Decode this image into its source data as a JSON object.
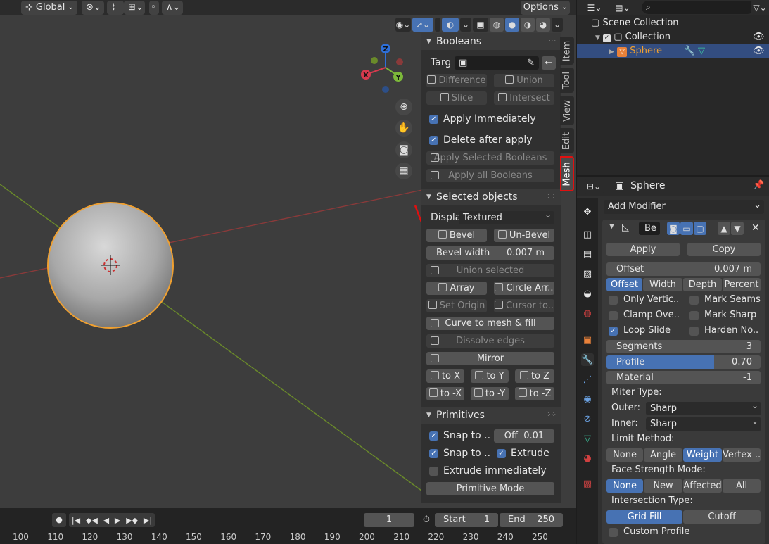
{
  "header": {
    "orientation": "Global",
    "options": "Options"
  },
  "booleans": {
    "title": "Booleans",
    "target_label": "Targ",
    "difference": "Difference",
    "union": "Union",
    "slice": "Slice",
    "intersect": "Intersect",
    "apply_immediately": "Apply Immediately",
    "delete_after_apply": "Delete after apply",
    "apply_selected": "Apply Selected Booleans",
    "apply_all": "Apply all Booleans"
  },
  "selected": {
    "title": "Selected objects",
    "display_label": "Displa",
    "display_value": "Textured",
    "bevel": "Bevel",
    "unbevel": "Un-Bevel",
    "bevel_width_label": "Bevel width",
    "bevel_width_value": "0.007 m",
    "union_selected": "Union selected",
    "array": "Array",
    "circle_array": "Circle Arr..",
    "set_origin": "Set Origin",
    "cursor_to": "Cursor to..",
    "curve_to_mesh": "Curve to mesh & fill",
    "dissolve_edges": "Dissolve edges",
    "mirror": "Mirror",
    "to_x": "to X",
    "to_y": "to Y",
    "to_z": "to Z",
    "to_nx": "to -X",
    "to_ny": "to -Y",
    "to_nz": "to -Z"
  },
  "primitives": {
    "title": "Primitives",
    "snap_to_1": "Snap to ..",
    "off_label": "Off",
    "off_value": "0.01",
    "snap_to_2": "Snap to ..",
    "extrude": "Extrude",
    "extrude_immediately": "Extrude immediately",
    "primitive_mode": "Primitive Mode"
  },
  "tabs": [
    "Item",
    "Tool",
    "View",
    "Edit",
    "Mesh"
  ],
  "gizmo": {
    "x": "X",
    "y": "Y",
    "z": "Z"
  },
  "outliner": {
    "scene_collection": "Scene Collection",
    "collection": "Collection",
    "sphere": "Sphere"
  },
  "properties": {
    "object_name": "Sphere",
    "add_modifier": "Add Modifier",
    "modifier_name": "Be",
    "apply": "Apply",
    "copy": "Copy",
    "offset_label": "Offset",
    "offset_value": "0.007 m",
    "width_modes": [
      "Offset",
      "Width",
      "Depth",
      "Percent"
    ],
    "only_vertices": "Only Vertic..",
    "mark_seams": "Mark Seams",
    "clamp_overlap": "Clamp Ove..",
    "mark_sharp": "Mark Sharp",
    "loop_slide": "Loop Slide",
    "harden_normals": "Harden No..",
    "segments_label": "Segments",
    "segments_value": "3",
    "profile_label": "Profile",
    "profile_value": "0.70",
    "profile_fraction": 0.7,
    "material_label": "Material",
    "material_value": "-1",
    "miter_type": "Miter Type:",
    "outer_label": "Outer:",
    "outer_value": "Sharp",
    "inner_label": "Inner:",
    "inner_value": "Sharp",
    "limit_method": "Limit Method:",
    "limit_modes": [
      "None",
      "Angle",
      "Weight",
      "Vertex .."
    ],
    "face_strength": "Face Strength Mode:",
    "face_modes": [
      "None",
      "New",
      "Affected",
      "All"
    ],
    "intersection_type": "Intersection Type:",
    "intersection_modes": [
      "Grid Fill",
      "Cutoff"
    ],
    "custom_profile": "Custom Profile"
  },
  "timeline": {
    "current_frame": "1",
    "start_label": "Start",
    "start_value": "1",
    "end_label": "End",
    "end_value": "250",
    "ruler": [
      "100",
      "110",
      "120",
      "130",
      "140",
      "150",
      "160",
      "170",
      "180",
      "190",
      "200",
      "210",
      "220",
      "230",
      "240",
      "250"
    ]
  },
  "colors": {
    "accent": "#4772b3",
    "selection": "#f0a030",
    "sphere_icon": "#e8813a"
  }
}
